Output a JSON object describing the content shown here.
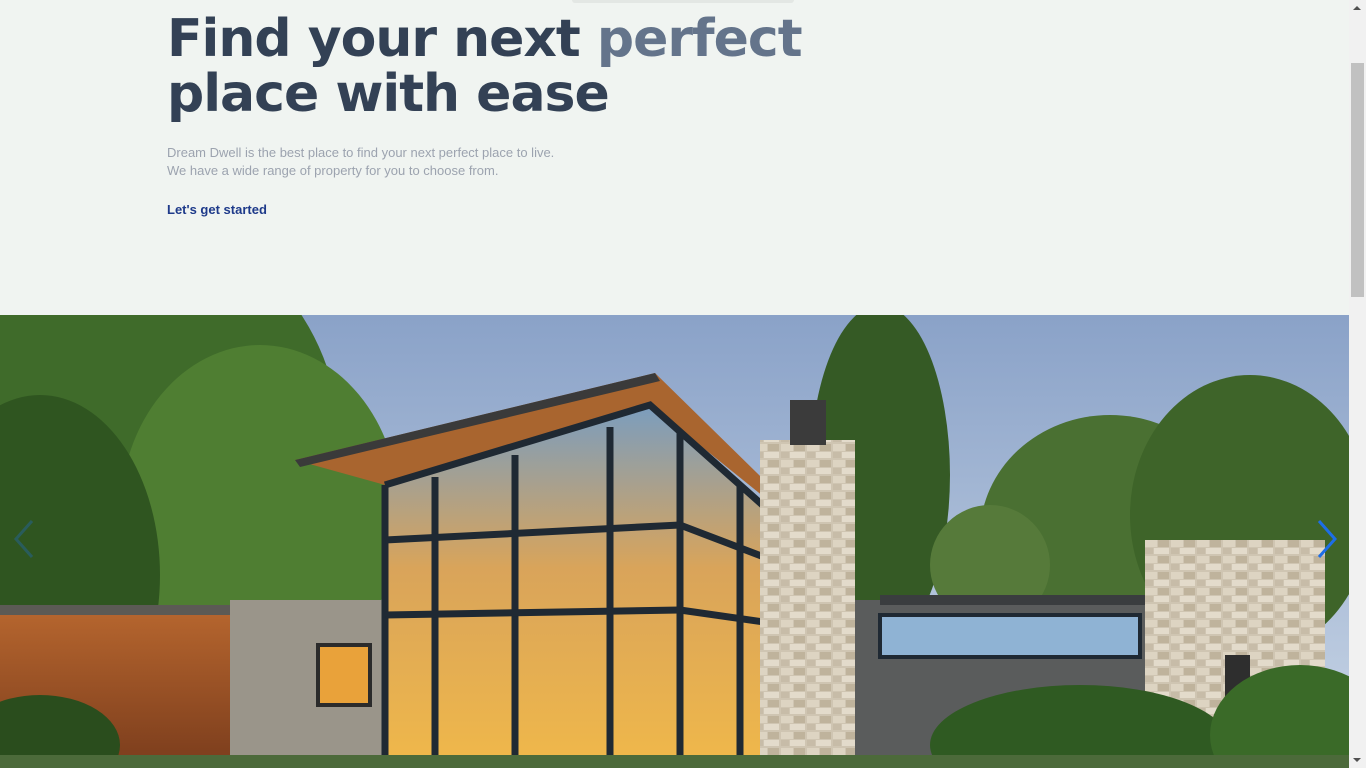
{
  "hero": {
    "headline_part1": "Find your next ",
    "headline_accent": "perfect",
    "headline_part2": "place with ease",
    "subtext_line1": "Dream Dwell is the best place to find your next perfect place to live.",
    "subtext_line2": "We have a wide range of property for you to choose from.",
    "cta_label": "Let's get started"
  },
  "carousel": {
    "image": "modern-glass-and-stone-house-photo",
    "prev_icon": "chevron-left-icon",
    "next_icon": "chevron-right-icon"
  },
  "colors": {
    "background": "#f0f4f1",
    "headline": "#334155",
    "accent": "#64748b",
    "cta": "#1e3a8a",
    "arrow": "#1d6ee8"
  }
}
